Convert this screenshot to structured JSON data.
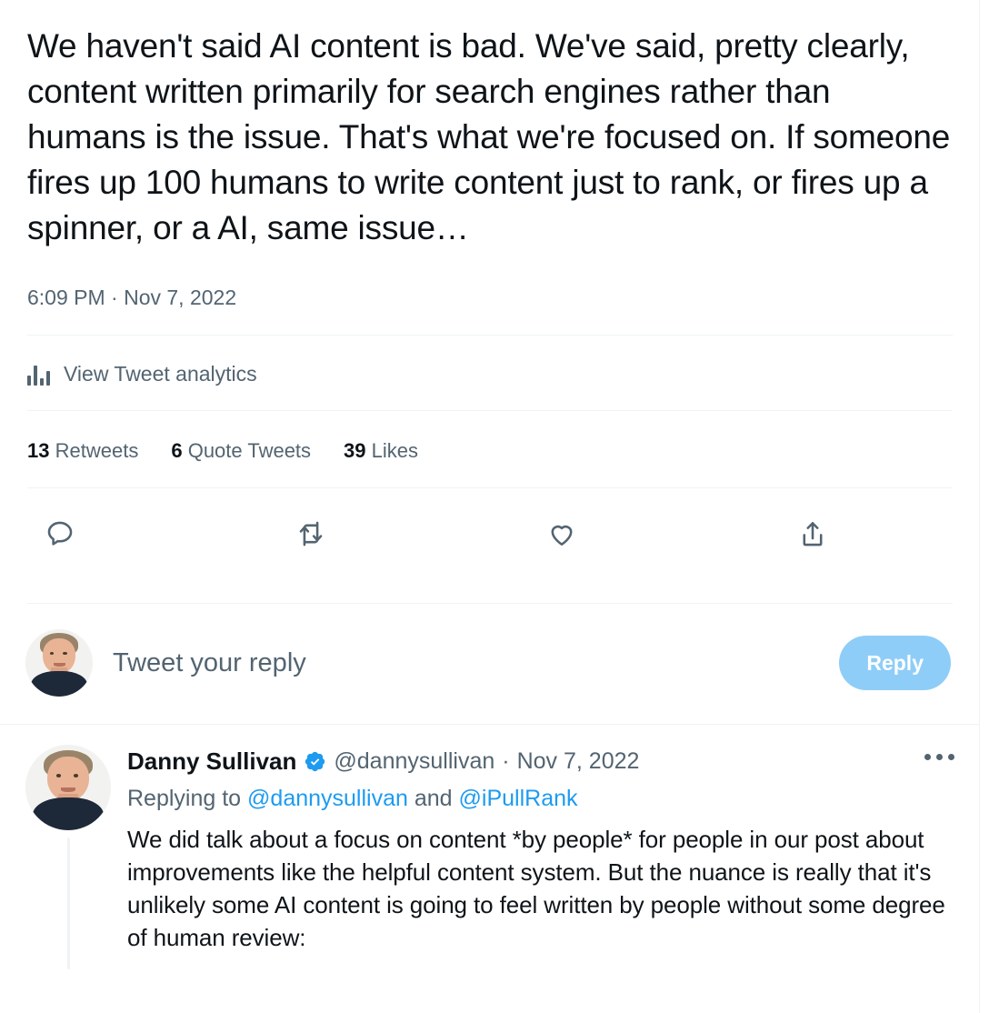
{
  "main_tweet": {
    "text": "We haven't said AI content is bad. We've said, pretty clearly, content written primarily for search engines rather than humans is the issue. That's what we're focused on. If someone fires up 100 humans to write content just to rank, or fires up a spinner, or a AI, same issue…",
    "timestamp": "6:09 PM · Nov 7, 2022",
    "analytics_label": "View Tweet analytics",
    "analytics_icon": "bar-chart-icon",
    "stats": [
      {
        "count": "13",
        "label": "Retweets"
      },
      {
        "count": "6",
        "label": "Quote Tweets"
      },
      {
        "count": "39",
        "label": "Likes"
      }
    ],
    "actions": [
      {
        "name": "reply-icon"
      },
      {
        "name": "retweet-icon"
      },
      {
        "name": "like-icon"
      },
      {
        "name": "share-icon"
      }
    ]
  },
  "composer": {
    "placeholder": "Tweet your reply",
    "reply_button_label": "Reply",
    "avatar_name": "user-avatar"
  },
  "reply_tweet": {
    "display_name": "Danny Sullivan",
    "verified": true,
    "handle": "@dannysullivan",
    "separator": "·",
    "date": "Nov 7, 2022",
    "replying_to_prefix": "Replying to",
    "replying_to_mentions": [
      "@dannysullivan",
      "@iPullRank"
    ],
    "replying_to_conjunction": "and",
    "body": "We did talk about a focus on content *by people* for people in our post about improvements like the helpful content system. But the nuance is really that it's unlikely some AI content is going to feel written by people without some degree of human review:",
    "more_menu_icon": "more-horizontal-icon"
  },
  "colors": {
    "text_primary": "#0f1419",
    "text_secondary": "#536471",
    "link_blue": "#1d9bf0",
    "verified_blue": "#1d9bf0",
    "reply_button_disabled": "#8ecdf8",
    "divider": "#eff3f4",
    "background": "#ffffff"
  }
}
